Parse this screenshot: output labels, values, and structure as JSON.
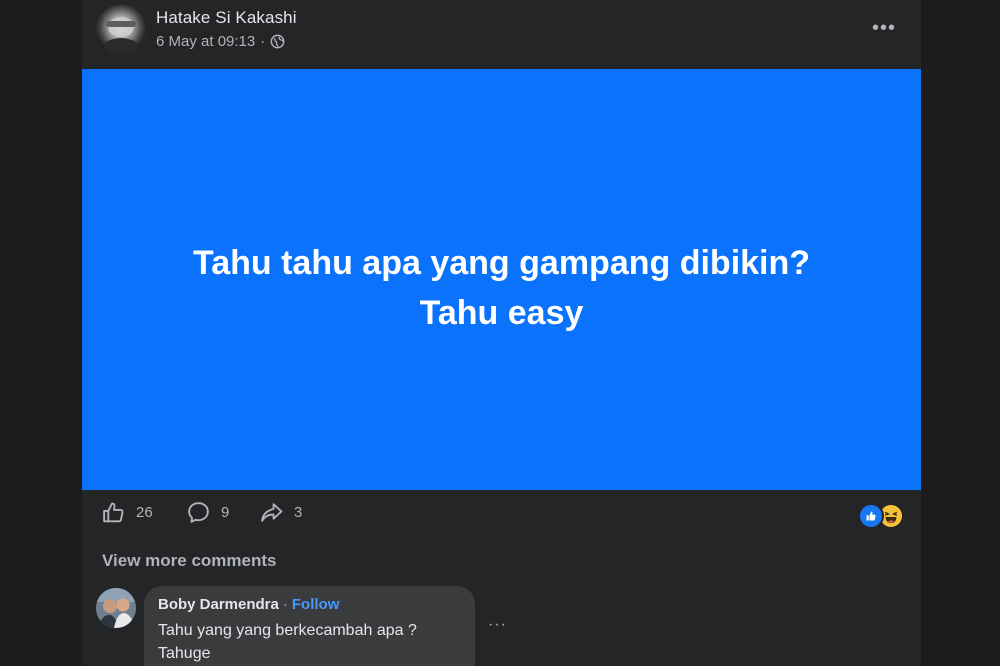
{
  "post": {
    "author": "Hatake Si Kakashi",
    "timestamp": "6 May at 09:13",
    "separator": "·",
    "privacy_icon": "globe-icon",
    "more_icon": "more-horizontal-icon",
    "more_glyph": "•••",
    "text_line_1": "Tahu tahu apa yang gampang dibikin?",
    "text_line_2": "Tahu easy",
    "background_color": "#0a72fb"
  },
  "actions": {
    "likes": "26",
    "comments": "9",
    "shares": "3"
  },
  "reactions": [
    "like-icon",
    "haha-icon"
  ],
  "comments_section": {
    "view_more_label": "View more comments",
    "comment": {
      "author": "Boby Darmendra",
      "separator": "·",
      "follow_label": "Follow",
      "text": "Tahu yang yang berkecambah apa ?\nTahuge",
      "more_glyph": "···"
    }
  },
  "colors": {
    "card_background": "#242526",
    "page_background": "#1c1c1c",
    "accent_blue": "#1877f2",
    "follow_blue": "#4599ff"
  }
}
